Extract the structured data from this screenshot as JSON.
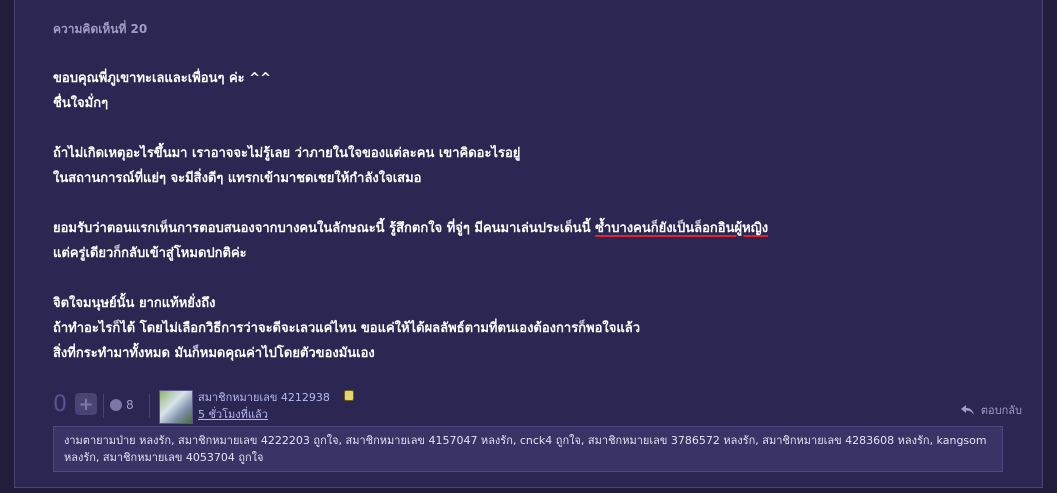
{
  "comment": {
    "number_label": "ความคิดเห็นที่ 20",
    "lines": [
      "ขอบคุณพี่ภูเขาทะเลและเพื่อนๆ ค่ะ ^^",
      "ชื่นใจมั่กๆ",
      "",
      "ถ้าไม่เกิดเหตุอะไรขึ้นมา เราอาจจะไม่รู้เลย ว่าภายในใจของแต่ละคน เขาคิดอะไรอยู่",
      "ในสถานการณ์ที่แย่ๆ จะมีสิ่งดีๆ แทรกเข้ามาชดเชยให้กำลังใจเสมอ",
      "",
      "",
      "แต่ครู่เดียวก็กลับเข้าสู่โหมดปกติค่ะ",
      "",
      "จิตใจมนุษย์นั้น ยากแท้หยั่งถึง",
      "ถ้าทำอะไรก็ได้ โดยไม่เลือกวิธีการว่าจะดีจะเลวแค่ไหน ขอแค่ให้ได้ผลลัพธ์ตามที่ตนเองต้องการก็พอใจแล้ว",
      "สิ่งที่กระทำมาทั้งหมด มันก็หมดคุณค่าไปโดยตัวของมันเอง"
    ],
    "line7_prefix": "ยอมรับว่าตอนแรกเห็นการตอบสนองจากบางคนในลักษณะนี้ รู้สึกตกใจ ที่จู่ๆ มีคนมาเล่นประเด็นนี้ ",
    "line7_highlight": "ซ้ำบางคนก็ยังเป็นล็อกอินผู้หญิง"
  },
  "footer": {
    "vote_count": "0",
    "plus_label": "+",
    "emotion_count": "8",
    "user_name": "สมาชิกหมายเลข 4212938",
    "time_ago": "5 ชั่วโมงที่แล้ว",
    "reply_label": "ตอบกลับ"
  },
  "reactions_text": "งามตายามป่าย หลงรัก, สมาชิกหมายเลข 4222203 ถูกใจ, สมาชิกหมายเลข 4157047 หลงรัก, cnck4 ถูกใจ, สมาชิกหมายเลข 3786572 หลงรัก, สมาชิกหมายเลข 4283608 หลงรัก, kangsom หลงรัก, สมาชิกหมายเลข 4053704 ถูกใจ",
  "colors": {
    "background": "#221d3b",
    "card": "#2c2652",
    "highlight_underline": "#e0232c",
    "link": "#b4b8f2"
  }
}
